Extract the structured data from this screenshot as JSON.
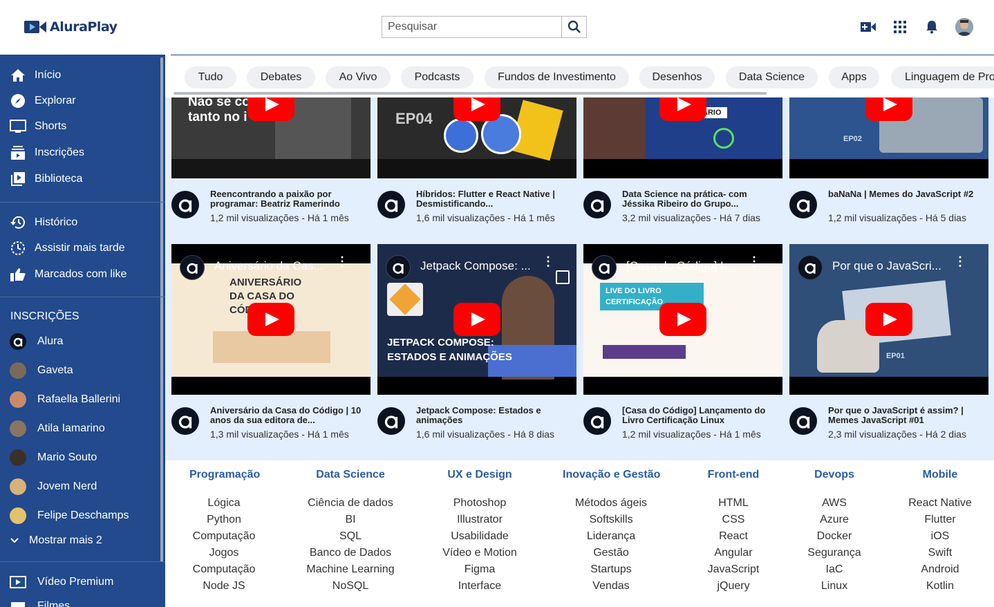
{
  "header": {
    "logo_text": "AluraPlay",
    "search_placeholder": "Pesquisar"
  },
  "sidebar": {
    "main": [
      {
        "label": "Início",
        "icon": "home-icon"
      },
      {
        "label": "Explorar",
        "icon": "compass-icon"
      },
      {
        "label": "Shorts",
        "icon": "shorts-icon"
      },
      {
        "label": "Inscrições",
        "icon": "subscriptions-icon"
      },
      {
        "label": "Biblioteca",
        "icon": "library-icon"
      }
    ],
    "secondary": [
      {
        "label": "Histórico",
        "icon": "history-icon"
      },
      {
        "label": "Assistir mais tarde",
        "icon": "clock-icon"
      },
      {
        "label": "Marcados com like",
        "icon": "thumbs-up-icon"
      }
    ],
    "subs_heading": "INSCRIÇÕES",
    "subscriptions": [
      {
        "label": "Alura",
        "color": "#0b1220"
      },
      {
        "label": "Gaveta",
        "color": "#7b6a5a"
      },
      {
        "label": "Rafaella Ballerini",
        "color": "#c98a6a"
      },
      {
        "label": "Atila Iamarino",
        "color": "#8a7462"
      },
      {
        "label": "Mario Souto",
        "color": "#3c2f2a"
      },
      {
        "label": "Jovem Nerd",
        "color": "#d9b27a"
      },
      {
        "label": "Felipe Deschamps",
        "color": "#e2c36b"
      }
    ],
    "show_more": "Mostrar mais 2",
    "bottom": [
      {
        "label": "Vídeo Premium",
        "icon": "premium-icon"
      },
      {
        "label": "Filmes",
        "icon": "movies-icon"
      }
    ]
  },
  "chips": [
    "Tudo",
    "Debates",
    "Ao Vivo",
    "Podcasts",
    "Fundos de Investimento",
    "Desenhos",
    "Data Science",
    "Apps",
    "Linguagem de Programação"
  ],
  "videos_row1": [
    {
      "title": "Reencontrando a paixão por programar: Beatriz Ramerindo",
      "info": "1,2 mil visualizações - Há 1 mês",
      "thumb_text": "Não se co tanto no i"
    },
    {
      "title": "Híbridos: Flutter e React Native | Desmistificando...",
      "info": "1,6 mil visualizações - Há 1 mês",
      "thumb_text": "EP04"
    },
    {
      "title": "Data Science na prática- com Jéssika Ribeiro do Grupo...",
      "info": "3,2 mil visualizações - Há 7 dias",
      "thumb_text": "o BOTICÁRIO"
    },
    {
      "title": "baNaNa | Memes do JavaScript #2",
      "info": "1,2 mil visualizações - Há 5 dias",
      "thumb_text": "EP02"
    }
  ],
  "videos_row2": [
    {
      "title": "Aniversário da Casa do Código | 10 anos da sua editora de...",
      "info": "1,3 mil visualizações - Há 1 mês",
      "overlay": "Aniversário da Cas...",
      "thumb_text": "ANIVERSÁRIO DA CASA DO CÓDIGO"
    },
    {
      "title": "Jetpack Compose: Estados e animações",
      "info": "1,6 mil visualizações - Há 8 dias",
      "overlay": "Jetpack Compose: ...",
      "thumb_text": "JETPACK COMPOSE: ESTADOS E ANIMAÇÕES"
    },
    {
      "title": "[Casa do Código] Lançamento do Livro Certificação Linux",
      "info": "1,2 mil visualizações - Há 1 mês",
      "overlay": "[Casa do Código] L...",
      "thumb_text": "LIVE DO LIVRO CERTIFICAÇÃO"
    },
    {
      "title": "Por que o JavaScript é assim? | Memes JavaScript #01",
      "info": "2,3 mil visualizações - Há 2 dias",
      "overlay": "Por que o JavaScri...",
      "thumb_text": "EP01"
    }
  ],
  "footer": [
    {
      "heading": "Programação",
      "links": [
        "Lógica",
        "Python",
        "Computação",
        "Jogos",
        "Computação",
        "Node JS"
      ]
    },
    {
      "heading": "Data Science",
      "links": [
        "Ciência de dados",
        "BI",
        "SQL",
        "Banco de Dados",
        "Machine Learning",
        "NoSQL"
      ]
    },
    {
      "heading": "UX e Design",
      "links": [
        "Photoshop",
        "Illustrator",
        "Usabilidade",
        "Vídeo e Motion",
        "Figma",
        "Interface"
      ]
    },
    {
      "heading": "Inovação e Gestão",
      "links": [
        "Métodos ágeis",
        "Softskills",
        "Liderança",
        "Gestão",
        "Startups",
        "Vendas"
      ]
    },
    {
      "heading": "Front-end",
      "links": [
        "HTML",
        "CSS",
        "React",
        "Angular",
        "JavaScript",
        "jQuery"
      ]
    },
    {
      "heading": "Devops",
      "links": [
        "AWS",
        "Azure",
        "Docker",
        "Segurança",
        "IaC",
        "Linux"
      ]
    },
    {
      "heading": "Mobile",
      "links": [
        "React Native",
        "Flutter",
        "iOS",
        "Swift",
        "Android",
        "Kotlin"
      ]
    }
  ],
  "colors": {
    "sidebar": "#224a8c",
    "content_bg": "#e3effd",
    "footer_heading": "#2a5ca8",
    "play": "#ff0000"
  }
}
